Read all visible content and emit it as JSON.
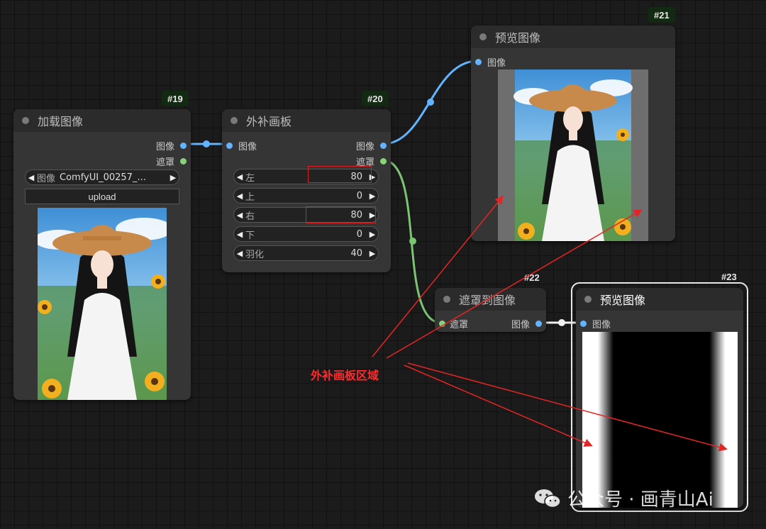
{
  "nodes": {
    "load_image": {
      "id": "#19",
      "title": "加载图像",
      "outputs": [
        "图像",
        "遮罩"
      ],
      "image_widget": {
        "label": "图像",
        "value": "ComfyUI_00257_..."
      },
      "upload_label": "upload"
    },
    "pad_canvas": {
      "id": "#20",
      "title": "外补画板",
      "input": "图像",
      "outputs": [
        "图像",
        "遮罩"
      ],
      "params": [
        {
          "label": "左",
          "value": "80"
        },
        {
          "label": "上",
          "value": "0"
        },
        {
          "label": "右",
          "value": "80"
        },
        {
          "label": "下",
          "value": "0"
        },
        {
          "label": "羽化",
          "value": "40"
        }
      ]
    },
    "preview1": {
      "id": "#21",
      "title": "预览图像",
      "input": "图像"
    },
    "mask_to_image": {
      "id": "#22",
      "title": "遮罩到图像",
      "input": "遮罩",
      "output": "图像"
    },
    "preview2": {
      "id": "#23",
      "title": "预览图像",
      "input": "图像"
    }
  },
  "annotation": {
    "text": "外补画板区域",
    "color": "#ff2a2a"
  },
  "watermark": {
    "text": "公众号 · 画青山Ai",
    "icon": "wechat-icon"
  },
  "colors": {
    "image_link": "#63b3ff",
    "mask_link": "#7bc472",
    "background": "#1b1b1b",
    "node_body": "#353535",
    "badge": "#122a12"
  }
}
